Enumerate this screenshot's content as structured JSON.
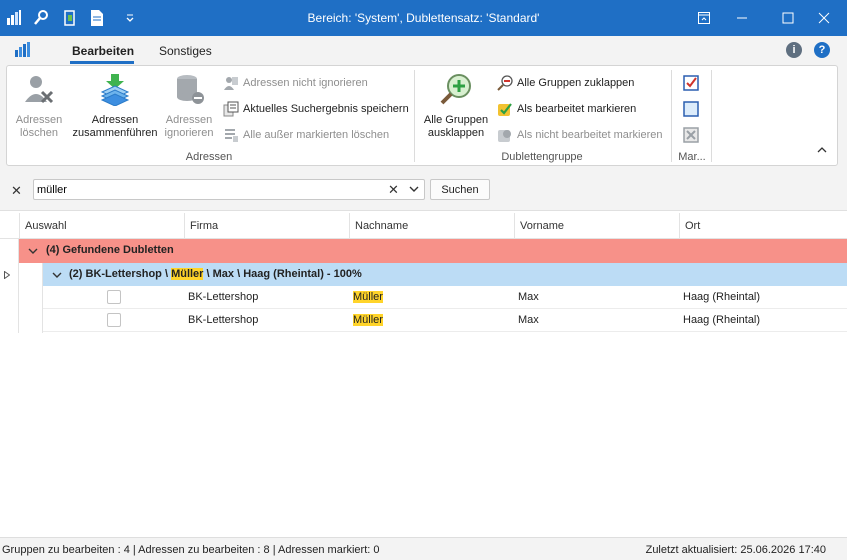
{
  "window": {
    "title": "Bereich: 'System', Dublettensatz: 'Standard'"
  },
  "ribbon": {
    "tabs": [
      {
        "label": "Bearbeiten",
        "active": true
      },
      {
        "label": "Sonstiges",
        "active": false
      }
    ],
    "groups": {
      "adressen": {
        "label": "Adressen",
        "delete": "Adressen\nlöschen",
        "merge": "Adressen\nzusammenführen",
        "ignore": "Adressen\nignorieren",
        "not_ignore": "Adressen nicht ignorieren",
        "save_result": "Aktuelles Suchergebnis speichern",
        "delete_all_but_marked": "Alle außer markierten  löschen"
      },
      "dublettengruppe": {
        "label": "Dublettengruppe",
        "collapse_all": "Alle Gruppen\nausklappen",
        "collapse_groups": "Alle Gruppen zuklappen",
        "mark_processed": "Als bearbeitet markieren",
        "mark_unprocessed": "Als nicht bearbeitet markieren"
      },
      "markieren": {
        "label": "Mar..."
      }
    }
  },
  "search": {
    "value": "müller",
    "button_label": "Suchen"
  },
  "grid": {
    "columns": [
      "Auswahl",
      "Firma",
      "Nachname",
      "Vorname",
      "Ort"
    ],
    "group1_label": "(4) Gefundene Dubletten",
    "group2": {
      "prefix": "(2) BK-Lettershop \\ ",
      "highlight": "Müller",
      "suffix": " \\ Max \\ Haag (Rheintal) - 100%"
    },
    "rows": [
      {
        "firma": "BK-Lettershop",
        "nachname": "Müller",
        "vorname": "Max",
        "ort": "Haag (Rheintal)"
      },
      {
        "firma": "BK-Lettershop",
        "nachname": "Müller",
        "vorname": "Max",
        "ort": "Haag (Rheintal)"
      }
    ]
  },
  "status": {
    "left": "Gruppen zu bearbeiten : 4 | Adressen zu bearbeiten : 8 | Adressen markiert: 0",
    "right": "Zuletzt aktualisiert: 25.06.2026 17:40"
  },
  "colors": {
    "titlebar": "#1f6fc5",
    "group1_row": "#f79189",
    "group2_row": "#bcdcf5",
    "highlight": "#ffd42a"
  }
}
